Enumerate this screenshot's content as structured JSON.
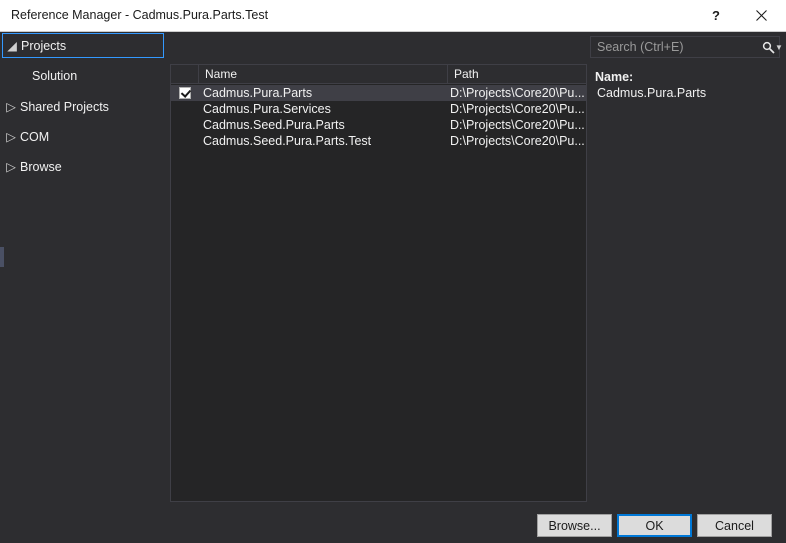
{
  "window": {
    "title": "Reference Manager - Cadmus.Pura.Parts.Test",
    "help_label": "?",
    "close_label": "✕"
  },
  "sidebar": {
    "items": [
      {
        "label": "Projects",
        "arrow": "◢",
        "selected": true,
        "child": false
      },
      {
        "label": "Solution",
        "arrow": "",
        "selected": false,
        "child": true
      },
      {
        "label": "Shared Projects",
        "arrow": "▷",
        "selected": false,
        "child": false
      },
      {
        "label": "COM",
        "arrow": "▷",
        "selected": false,
        "child": false
      },
      {
        "label": "Browse",
        "arrow": "▷",
        "selected": false,
        "child": false
      }
    ]
  },
  "list": {
    "columns": [
      "",
      "Name",
      "Path"
    ],
    "rows": [
      {
        "checked": true,
        "name": "Cadmus.Pura.Parts",
        "path": "D:\\Projects\\Core20\\Pu...",
        "selected": true
      },
      {
        "checked": false,
        "name": "Cadmus.Pura.Services",
        "path": "D:\\Projects\\Core20\\Pu...",
        "selected": false
      },
      {
        "checked": false,
        "name": "Cadmus.Seed.Pura.Parts",
        "path": "D:\\Projects\\Core20\\Pu...",
        "selected": false
      },
      {
        "checked": false,
        "name": "Cadmus.Seed.Pura.Parts.Test",
        "path": "D:\\Projects\\Core20\\Pu...",
        "selected": false
      }
    ]
  },
  "search": {
    "placeholder": "Search (Ctrl+E)",
    "value": ""
  },
  "details": {
    "name_label": "Name:",
    "name_value": "Cadmus.Pura.Parts"
  },
  "footer": {
    "browse_label": "Browse...",
    "ok_label": "OK",
    "cancel_label": "Cancel"
  },
  "colors": {
    "accent": "#3399ff",
    "focus": "#0078d7",
    "window_bg": "#2d2d30",
    "list_bg": "#252526",
    "selection": "#3f3f46",
    "titlebar_bg": "#ffffff"
  }
}
